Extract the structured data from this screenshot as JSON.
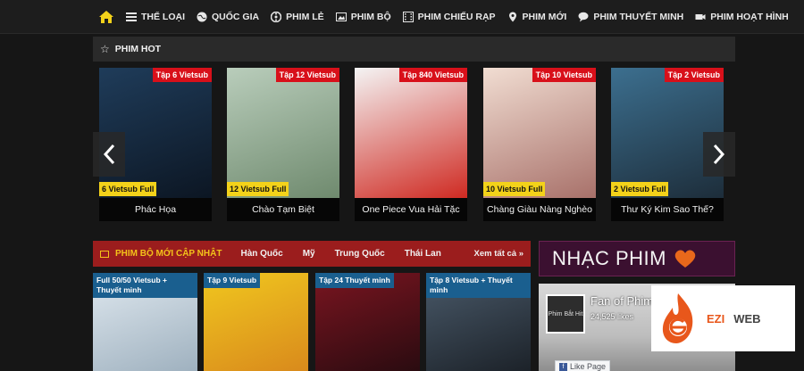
{
  "nav": {
    "items": [
      {
        "label": "THỂ LOẠI",
        "icon": "list-icon"
      },
      {
        "label": "QUỐC GIA",
        "icon": "globe-icon"
      },
      {
        "label": "PHIM LẺ",
        "icon": "film-reel-icon"
      },
      {
        "label": "PHIM BỘ",
        "icon": "image-icon"
      },
      {
        "label": "PHIM CHIẾU RẠP",
        "icon": "film-strip-icon"
      },
      {
        "label": "PHIM MỚI",
        "icon": "location-icon"
      },
      {
        "label": "PHIM THUYẾT MINH",
        "icon": "speech-bubble-icon"
      },
      {
        "label": "PHIM HOẠT HÌNH",
        "icon": "video-camera-icon"
      }
    ],
    "home_icon": "home-icon"
  },
  "hot": {
    "title": "PHIM HOT",
    "cards": [
      {
        "top_badge": "Tập 6 Vietsub",
        "bottom_badge": "6 Vietsub Full",
        "title": "Phác Họa",
        "color1": "#1f3c5a",
        "color2": "#0c1623"
      },
      {
        "top_badge": "Tập 12 Vietsub",
        "bottom_badge": "12 Vietsub Full",
        "title": "Chào Tạm Biệt",
        "color1": "#b9cdbb",
        "color2": "#6f8a6e"
      },
      {
        "top_badge": "Tập 840 Vietsub",
        "bottom_badge": "",
        "title": "One Piece Vua Hải Tặc",
        "color1": "#f4f4f4",
        "color2": "#cf2a22"
      },
      {
        "top_badge": "Tập 10 Vietsub",
        "bottom_badge": "10 Vietsub Full",
        "title": "Chàng Giàu Nàng Nghèo",
        "color1": "#f1ddd2",
        "color2": "#a8716a"
      },
      {
        "top_badge": "Tập 2 Vietsub",
        "bottom_badge": "2 Vietsub Full",
        "title": "Thư Ký Kim Sao Thế?",
        "color1": "#3c6f8f",
        "color2": "#1d2d3a"
      }
    ]
  },
  "new_series": {
    "title": "PHIM BỘ MỚI CẬP NHẬT",
    "tabs": [
      "Hàn Quốc",
      "Mỹ",
      "Trung Quốc",
      "Thái Lan"
    ],
    "see_all": "Xem tất cả »",
    "cards": [
      {
        "badge": "Full 50/50 Vietsub + Thuyết minh",
        "color1": "#dfe8ef",
        "color2": "#9fb1bf"
      },
      {
        "badge": "Tập 9 Vietsub",
        "color1": "#f0c71f",
        "color2": "#d98a1c"
      },
      {
        "badge": "Tập 24 Thuyết minh",
        "color1": "#7a1520",
        "color2": "#2a0b10"
      },
      {
        "badge": "Tập 8 Vietsub + Thuyết minh",
        "color1": "#4a5a6a",
        "color2": "#1c2229"
      }
    ]
  },
  "nhac_phim": {
    "title": "NHẠC PHIM"
  },
  "facebook": {
    "page_name": "Fan of Phim",
    "likes": "24,525 likes",
    "like_button": "Like Page",
    "thumb_text": "Phim Bắt Hit"
  },
  "ezi": {
    "w1": "EZI",
    "w2": "WEB"
  }
}
